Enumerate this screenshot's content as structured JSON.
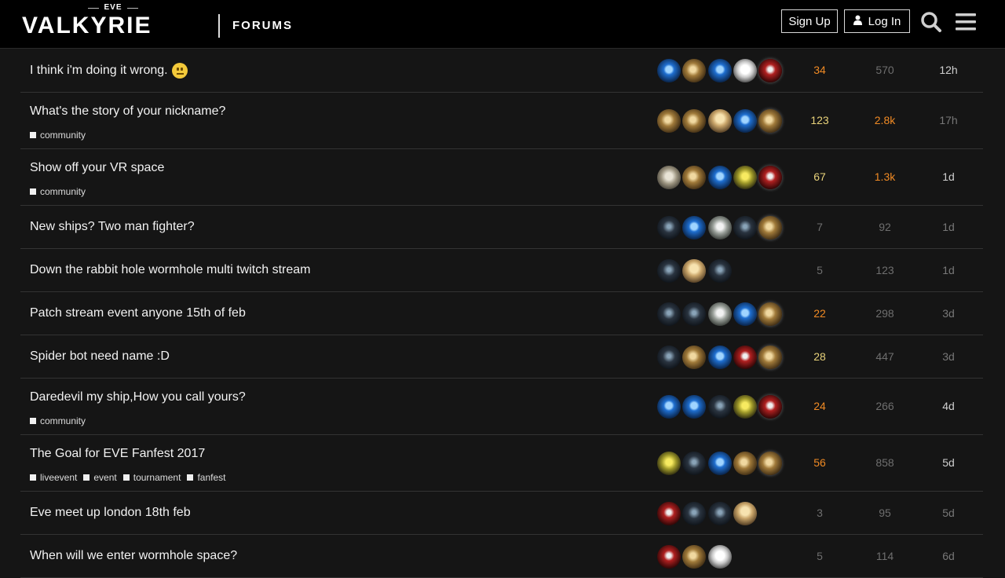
{
  "header": {
    "logo_top": "EVE",
    "logo_main": "VALKYRIE",
    "logo_sub": "FORUMS",
    "signup_label": "Sign Up",
    "login_label": "Log In",
    "icons": [
      "user-icon",
      "search-icon",
      "menu-icon"
    ]
  },
  "colors": {
    "background": "#151515",
    "header_bg": "#000000",
    "row_border": "#333333",
    "hot_orange": "#f08a24",
    "warm_yellow": "#e8d27a",
    "muted_gray": "#6e6e6e",
    "title_white": "#f2f2f2"
  },
  "topics": [
    {
      "title": "I think i'm doing it wrong.",
      "emoji": "neutral-face-emoji",
      "tags": [],
      "replies": "34",
      "views": "570",
      "activity": "12h",
      "avatars": [
        "blue",
        "gold",
        "blue",
        "white",
        "red"
      ]
    },
    {
      "title": "What's the story of your nickname?",
      "tags": [
        "community"
      ],
      "replies": "123",
      "views": "2.8k",
      "activity": "17h",
      "avatars": [
        "gold",
        "gold",
        "blonde",
        "blue",
        "gold"
      ]
    },
    {
      "title": "Show off your VR space",
      "tags": [
        "community"
      ],
      "replies": "67",
      "views": "1.3k",
      "activity": "1d",
      "avatars": [
        "silver",
        "gold",
        "blue",
        "yellow",
        "red"
      ]
    },
    {
      "title": "New ships? Two man fighter?",
      "tags": [],
      "replies": "7",
      "views": "92",
      "activity": "1d",
      "avatars": [
        "dark",
        "blue",
        "gray",
        "dark",
        "gold"
      ]
    },
    {
      "title": "Down the rabbit hole wormhole multi twitch stream",
      "tags": [],
      "replies": "5",
      "views": "123",
      "activity": "1d",
      "avatars": [
        "dark",
        "blonde",
        "dark"
      ]
    },
    {
      "title": "Patch stream event anyone 15th of feb",
      "tags": [],
      "replies": "22",
      "views": "298",
      "activity": "3d",
      "avatars": [
        "dark",
        "dark",
        "gray",
        "blue",
        "gold"
      ]
    },
    {
      "title": "Spider bot need name :D",
      "tags": [],
      "replies": "28",
      "views": "447",
      "activity": "3d",
      "avatars": [
        "dark",
        "gold",
        "blue",
        "red",
        "gold"
      ]
    },
    {
      "title": "Daredevil my ship,How you call yours?",
      "tags": [
        "community"
      ],
      "replies": "24",
      "views": "266",
      "activity": "4d",
      "avatars": [
        "blue",
        "blue",
        "dark",
        "yellow",
        "red"
      ]
    },
    {
      "title": "The Goal for EVE Fanfest 2017",
      "tags": [
        "liveevent",
        "event",
        "tournament",
        "fanfest"
      ],
      "replies": "56",
      "views": "858",
      "activity": "5d",
      "avatars": [
        "yellow",
        "dark",
        "blue",
        "gold",
        "gold"
      ]
    },
    {
      "title": "Eve meet up london 18th feb",
      "tags": [],
      "replies": "3",
      "views": "95",
      "activity": "5d",
      "avatars": [
        "red",
        "dark",
        "dark",
        "blonde"
      ]
    },
    {
      "title": "When will we enter wormhole space?",
      "tags": [],
      "replies": "5",
      "views": "114",
      "activity": "6d",
      "avatars": [
        "red",
        "gold",
        "white"
      ]
    }
  ]
}
